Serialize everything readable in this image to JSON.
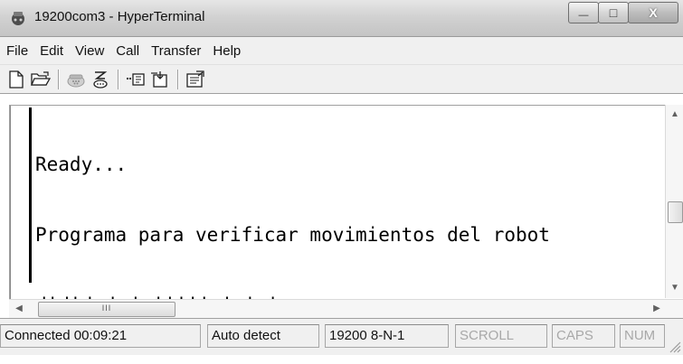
{
  "window": {
    "title": "19200com3 - HyperTerminal",
    "controls": {
      "minimize": "—",
      "maximize": "□",
      "close": "X"
    }
  },
  "menu": [
    "File",
    "Edit",
    "View",
    "Call",
    "Transfer",
    "Help"
  ],
  "toolbar": {
    "icons": [
      "new-file-icon",
      "open-folder-icon",
      "phone-icon",
      "disconnect-icon",
      "send-icon",
      "receive-icon",
      "properties-icon"
    ]
  },
  "terminal": {
    "lines": [
      "Ready...",
      "Programa para verificar movimientos del robot",
      "dididcdcdcdddddcdndndc"
    ]
  },
  "hscroll": {
    "grip": "III"
  },
  "status": {
    "connected": "Connected 00:09:21",
    "detect": "Auto detect",
    "settings": "19200 8-N-1",
    "scroll": "SCROLL",
    "caps": "CAPS",
    "num": "NUM"
  },
  "colors": {
    "chrome": "#f0f0f0",
    "terminal_bg": "#ffffff",
    "text": "#000000",
    "disabled": "#a8a8a8"
  }
}
